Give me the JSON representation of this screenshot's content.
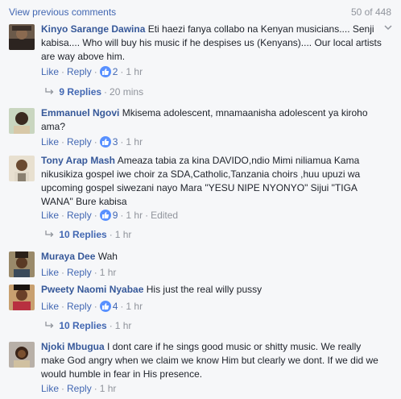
{
  "header": {
    "view_previous": "View previous comments",
    "counter": "50 of 448"
  },
  "labels": {
    "like": "Like",
    "reply": "Reply",
    "sep": "·"
  },
  "comments": [
    {
      "author": "Kinyo Sarange Dawina",
      "text": "Eti haezi fanya collabo na Kenyan musicians.... Senji kabisa.... Who will buy his music if he despises us (Kenyans).... Our local artists are way above him.",
      "likes": "2",
      "time": "1 hr",
      "replies": "9 Replies",
      "replies_time": "20 mins"
    },
    {
      "author": "Emmanuel Ngovi",
      "text": "Mkisema adolescent, mnamaanisha adolescent ya kiroho ama?",
      "likes": "3",
      "time": "1 hr"
    },
    {
      "author": "Tony Arap Mash",
      "text": "Ameaza tabia za kina DAVIDO,ndio Mimi niliamua Kama nikusikiza gospel iwe choir za SDA,Catholic,Tanzania choirs ,huu upuzi wa upcoming gospel siwezani nayo Mara \"YESU NIPE NYONYO\" Sijui \"TIGA WANA\" Bure kabisa",
      "likes": "9",
      "time": "1 hr",
      "edited": "Edited",
      "replies": "10 Replies",
      "replies_time": "1 hr"
    },
    {
      "author": "Muraya Dee",
      "text": "Wah",
      "time": "1 hr"
    },
    {
      "author": "Pweety Naomi Nyabae",
      "text": "His just the real willy pussy",
      "likes": "4",
      "time": "1 hr",
      "replies": "10 Replies",
      "replies_time": "1 hr"
    },
    {
      "author": "Njoki Mbugua",
      "text": "I dont care if he sings good music or shitty music. We really make God angry when we claim we know Him but clearly we dont. If we did we would humble in fear in His presence.",
      "time": "1 hr"
    }
  ],
  "colors": {
    "link": "#4267b2",
    "author": "#365899",
    "meta": "#90949c",
    "like_badge": "#5890ff"
  },
  "icons": {
    "like": "thumbs-up-icon",
    "reply_arrow": "reply-arrow-icon",
    "options": "chevron-down-icon"
  }
}
